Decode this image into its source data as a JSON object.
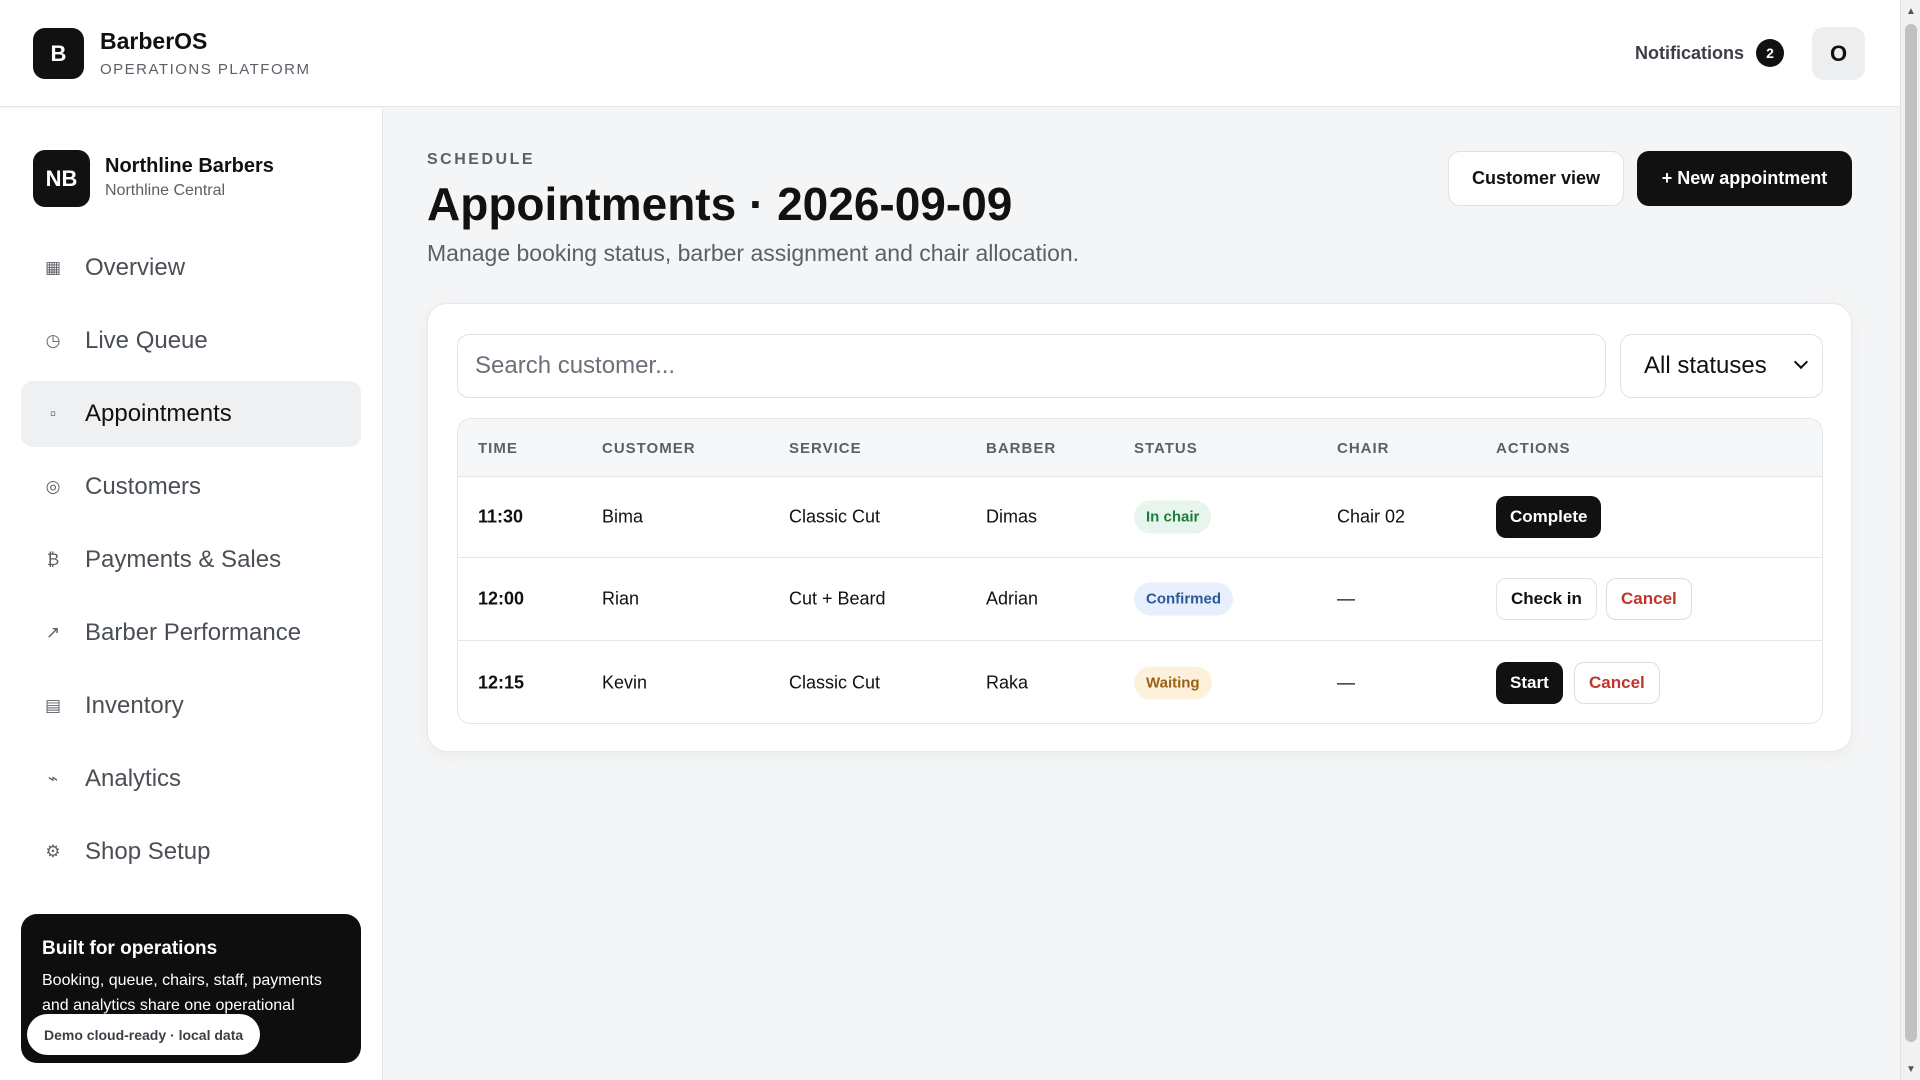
{
  "header": {
    "logo_letter": "B",
    "brand": "BarberOS",
    "brand_sub": "OPERATIONS PLATFORM",
    "notifications_label": "Notifications",
    "notifications_count": "2",
    "user_initial": "O"
  },
  "sidebar": {
    "shop_initials": "NB",
    "shop_name": "Northline Barbers",
    "shop_branch": "Northline Central",
    "items": [
      {
        "label": "Overview",
        "icon": "▦"
      },
      {
        "label": "Live Queue",
        "icon": "◷"
      },
      {
        "label": "Appointments",
        "icon": "▫"
      },
      {
        "label": "Customers",
        "icon": "◎"
      },
      {
        "label": "Payments & Sales",
        "icon": "₿"
      },
      {
        "label": "Barber Performance",
        "icon": "↗"
      },
      {
        "label": "Inventory",
        "icon": "▤"
      },
      {
        "label": "Analytics",
        "icon": "⌁"
      },
      {
        "label": "Shop Setup",
        "icon": "⚙"
      }
    ],
    "promo": {
      "title": "Built for operations",
      "text": "Booking, queue, chairs, staff, payments and analytics share one operational",
      "pill": "Demo cloud-ready · local data"
    }
  },
  "main": {
    "eyebrow": "SCHEDULE",
    "title": "Appointments · 2026-09-09",
    "subtitle": "Manage booking status, barber assignment and chair allocation.",
    "customer_view_label": "Customer view",
    "new_appointment_label": "+ New appointment",
    "search_placeholder": "Search customer...",
    "status_filter": "All statuses",
    "columns": [
      "TIME",
      "CUSTOMER",
      "SERVICE",
      "BARBER",
      "STATUS",
      "CHAIR",
      "ACTIONS"
    ],
    "rows": [
      {
        "time": "11:30",
        "customer": "Bima",
        "service": "Classic Cut",
        "barber": "Dimas",
        "status": "In chair",
        "chair": "Chair 02",
        "actions": [
          "Complete"
        ]
      },
      {
        "time": "12:00",
        "customer": "Rian",
        "service": "Cut + Beard",
        "barber": "Adrian",
        "status": "Confirmed",
        "chair": "—",
        "actions": [
          "Check in",
          "Cancel"
        ]
      },
      {
        "time": "12:15",
        "customer": "Kevin",
        "service": "Classic Cut",
        "barber": "Raka",
        "status": "Waiting",
        "chair": "—",
        "actions": [
          "Start",
          "Cancel"
        ]
      }
    ]
  }
}
